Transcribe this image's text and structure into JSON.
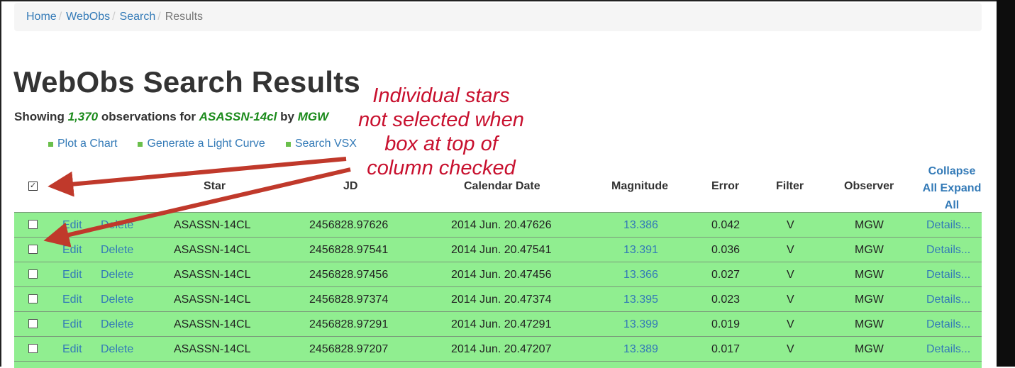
{
  "breadcrumb": [
    "Home",
    "WebObs",
    "Search",
    "Results"
  ],
  "page_title": "WebObs Search Results",
  "subtitle": {
    "prefix": "Showing",
    "count": "1,370",
    "middle": "observations for",
    "star": "ASASSN-14cl",
    "by": "by",
    "observer": "MGW"
  },
  "actions": [
    "Plot a Chart",
    "Generate a Light Curve",
    "Search VSX"
  ],
  "annotation": [
    "Individual stars",
    "not selected when",
    "box at top of",
    "column checked"
  ],
  "header_checkbox_checked": true,
  "header_check_mark": "✓",
  "columns": {
    "star": "Star",
    "jd": "JD",
    "calendar": "Calendar Date",
    "magnitude": "Magnitude",
    "error": "Error",
    "filter": "Filter",
    "observer": "Observer"
  },
  "toggle_links": [
    "Collapse",
    "All",
    "Expand",
    "All"
  ],
  "row_labels": {
    "edit": "Edit",
    "delete": "Delete",
    "details": "Details..."
  },
  "rows": [
    {
      "star": "ASASSN-14CL",
      "jd": "2456828.97626",
      "date": "2014 Jun. 20.47626",
      "mag": "13.386",
      "err": "0.042",
      "filter": "V",
      "observer": "MGW"
    },
    {
      "star": "ASASSN-14CL",
      "jd": "2456828.97541",
      "date": "2014 Jun. 20.47541",
      "mag": "13.391",
      "err": "0.036",
      "filter": "V",
      "observer": "MGW"
    },
    {
      "star": "ASASSN-14CL",
      "jd": "2456828.97456",
      "date": "2014 Jun. 20.47456",
      "mag": "13.366",
      "err": "0.027",
      "filter": "V",
      "observer": "MGW"
    },
    {
      "star": "ASASSN-14CL",
      "jd": "2456828.97374",
      "date": "2014 Jun. 20.47374",
      "mag": "13.395",
      "err": "0.023",
      "filter": "V",
      "observer": "MGW"
    },
    {
      "star": "ASASSN-14CL",
      "jd": "2456828.97291",
      "date": "2014 Jun. 20.47291",
      "mag": "13.399",
      "err": "0.019",
      "filter": "V",
      "observer": "MGW"
    },
    {
      "star": "ASASSN-14CL",
      "jd": "2456828.97207",
      "date": "2014 Jun. 20.47207",
      "mag": "13.389",
      "err": "0.017",
      "filter": "V",
      "observer": "MGW"
    }
  ],
  "colors": {
    "row_bg": "#90ee90",
    "link": "#337ab7",
    "annotation": "#c8102e",
    "arrow": "#c0392b",
    "highlight_green": "#1a8a1a"
  }
}
